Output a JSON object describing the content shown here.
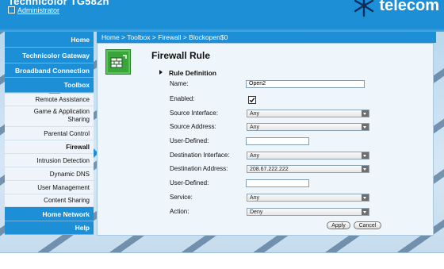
{
  "header": {
    "device_name": "Technicolor TG582n",
    "user_link": "Administrator",
    "brand": "telecom"
  },
  "sidebar": {
    "items": [
      {
        "label": "Home",
        "kind": "main"
      },
      {
        "label": "Technicolor Gateway",
        "kind": "main"
      },
      {
        "label": "Broadband Connection",
        "kind": "main"
      },
      {
        "label": "Toolbox",
        "kind": "main"
      },
      {
        "label": "Remote Assistance",
        "kind": "sub"
      },
      {
        "label": "Game & Application Sharing",
        "kind": "sub"
      },
      {
        "label": "Parental Control",
        "kind": "sub"
      },
      {
        "label": "Firewall",
        "kind": "sub",
        "active": true
      },
      {
        "label": "Intrusion Detection",
        "kind": "sub"
      },
      {
        "label": "Dynamic DNS",
        "kind": "sub"
      },
      {
        "label": "User Management",
        "kind": "sub"
      },
      {
        "label": "Content Sharing",
        "kind": "sub"
      },
      {
        "label": "Home Network",
        "kind": "main"
      },
      {
        "label": "Help",
        "kind": "main"
      }
    ],
    "game_sharing_line1": "Game & Application",
    "game_sharing_line2": "Sharing"
  },
  "breadcrumb": "Home > Toolbox > Firewall > Blockopen$0",
  "page": {
    "title": "Firewall Rule",
    "section": "Rule Definition"
  },
  "form": {
    "name_label": "Name:",
    "name_value": "Open2",
    "enabled_label": "Enabled:",
    "enabled_checked": true,
    "source_interface_label": "Source Interface:",
    "source_interface_value": "Any",
    "source_address_label": "Source Address:",
    "source_address_value": "Any",
    "user_defined_1_label": "User-Defined:",
    "user_defined_1_value": "",
    "destination_interface_label": "Destination Interface:",
    "destination_interface_value": "Any",
    "destination_address_label": "Destination Address:",
    "destination_address_value": "208.67.222.222",
    "user_defined_2_label": "User-Defined:",
    "user_defined_2_value": "",
    "service_label": "Service:",
    "service_value": "Any",
    "action_label": "Action:",
    "action_value": "Deny"
  },
  "buttons": {
    "apply": "Apply",
    "cancel": "Cancel"
  },
  "colors": {
    "accent": "#1c8fd6",
    "panel_bg": "#eef5fb",
    "icon_green": "#3aa63a"
  }
}
